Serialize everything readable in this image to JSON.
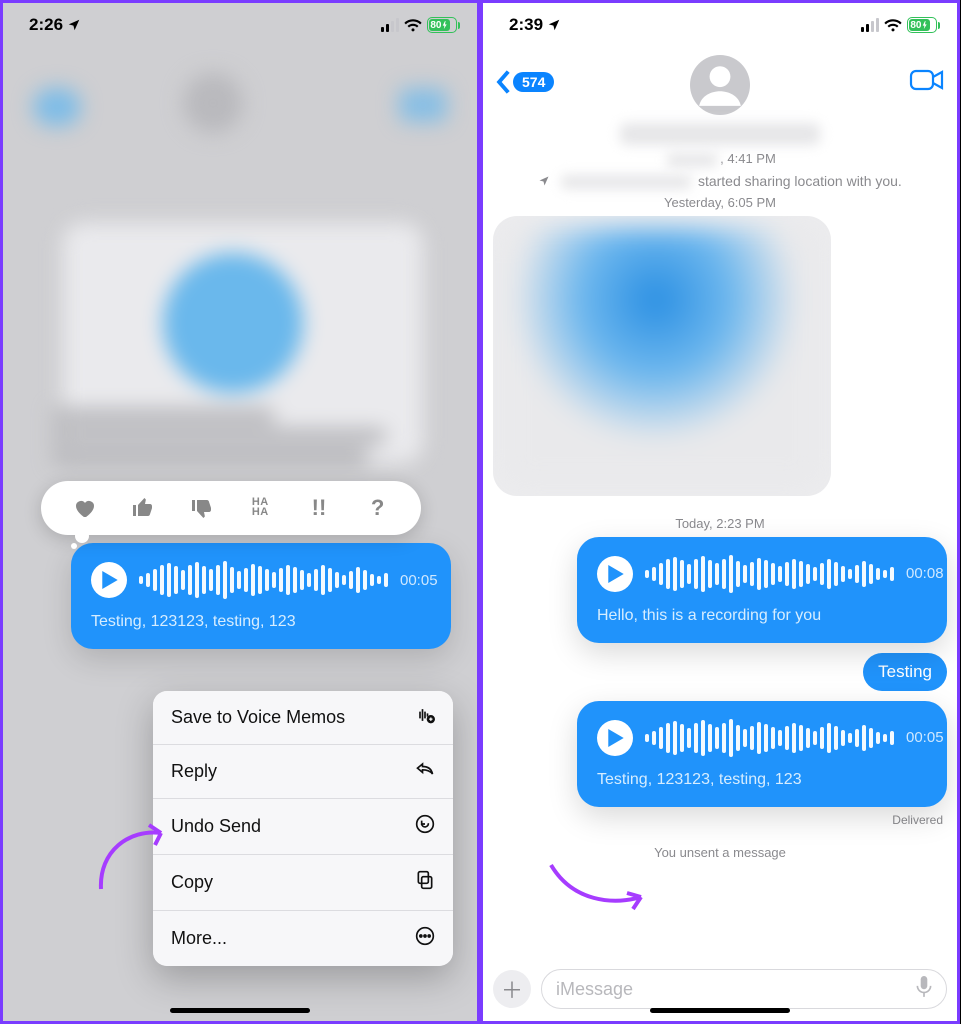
{
  "left": {
    "status": {
      "time": "2:26",
      "battery": "80"
    },
    "tapback": [
      "heart",
      "thumbs-up",
      "thumbs-down",
      "haha",
      "exclaim",
      "question"
    ],
    "bubble": {
      "duration": "00:05",
      "transcript": "Testing, 123123, testing, 123"
    },
    "menu": {
      "save": "Save to Voice Memos",
      "reply": "Reply",
      "undo": "Undo Send",
      "copy": "Copy",
      "more": "More..."
    }
  },
  "right": {
    "status": {
      "time": "2:39",
      "battery": "80"
    },
    "back_count": "574",
    "header_ts": ", 4:41 PM",
    "location_shared": "started sharing location with you.",
    "ts_yesterday": "Yesterday, 6:05 PM",
    "ts_today": "Today, 2:23 PM",
    "voice1": {
      "duration": "00:08",
      "transcript": "Hello, this is a recording for you"
    },
    "text_msg": "Testing",
    "voice2": {
      "duration": "00:05",
      "transcript": "Testing, 123123, testing, 123"
    },
    "delivered": "Delivered",
    "unsent": "You unsent a message",
    "input_placeholder": "iMessage"
  }
}
